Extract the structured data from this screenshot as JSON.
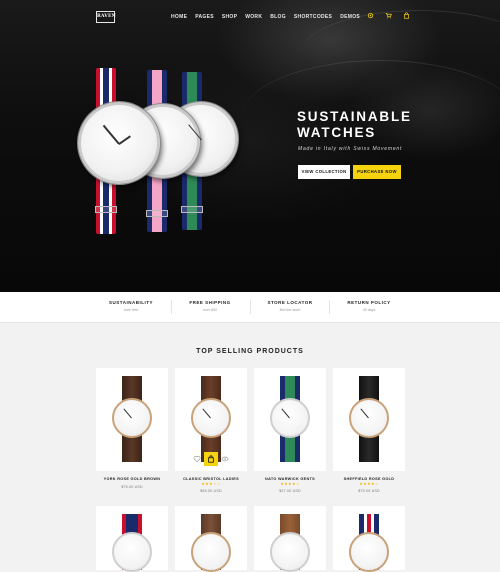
{
  "brand": {
    "logo_text": "RAVEN"
  },
  "nav": {
    "items": [
      "HOME",
      "PAGES",
      "SHOP",
      "WORK",
      "BLOG",
      "SHORTCODES",
      "DEMOS"
    ],
    "icons": [
      "settings-icon",
      "cart-icon",
      "bag-icon"
    ]
  },
  "hero": {
    "title_line1": "SUSTAINABLE",
    "title_line2": "WATCHES",
    "subtitle": "Made in Italy with Swiss Movement",
    "btn_primary": "VIEW COLLECTION",
    "btn_secondary": "PURCHASE NOW",
    "accent_color": "#f5d30f"
  },
  "features": [
    {
      "title": "SUSTAINABILITY",
      "sub": "toxic free"
    },
    {
      "title": "FREE SHIPPING",
      "sub": "over $50"
    },
    {
      "title": "STORE LOCATOR",
      "sub": "find the store"
    },
    {
      "title": "RETURN POLICY",
      "sub": "30 days"
    }
  ],
  "products": {
    "section_title": "TOP SELLING PRODUCTS",
    "items": [
      {
        "name": "YORK ROSE GOLD BROWN",
        "price": "$75.00 USD",
        "rating": null
      },
      {
        "name": "CLASSIC BRISTOL LADIES",
        "price": "$95.00 USD",
        "rating": "★★★☆☆"
      },
      {
        "name": "NATO WARWICK GENTS",
        "price": "$27.00 USD",
        "rating": "★★★★☆"
      },
      {
        "name": "SHEFFIELD ROSE GOLD",
        "price": "$75.00 USD",
        "rating": "★★★★☆"
      }
    ]
  }
}
